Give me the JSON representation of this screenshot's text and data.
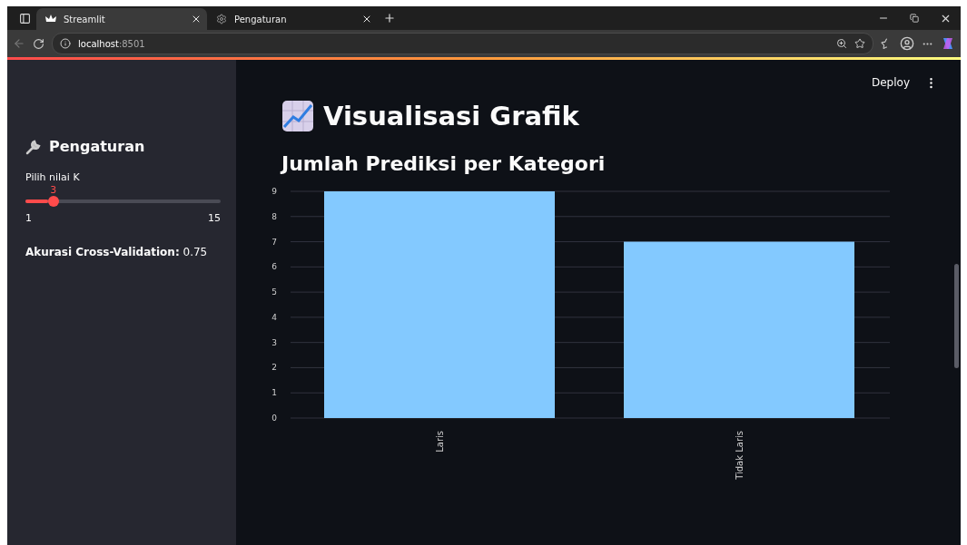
{
  "browser": {
    "tabs": [
      {
        "title": "Streamlit",
        "selected": true,
        "kind": "app"
      },
      {
        "title": "Pengaturan",
        "selected": false,
        "kind": "settings"
      }
    ],
    "address": {
      "host": "localhost",
      "port": ":8501"
    }
  },
  "header": {
    "deploy": "Deploy"
  },
  "sidebar": {
    "title": "Pengaturan",
    "slider": {
      "label": "Pilih nilai K",
      "value": "3",
      "min": "1",
      "max": "15",
      "level": 0.143
    },
    "accuracy": "**Akurasi Cross-Validation:** 0.75"
  },
  "main": {
    "title": "Visualisasi Grafik",
    "subtitle": "Jumlah Prediksi per Kategori",
    "chart_data": {
      "type": "bar",
      "grid": true,
      "categories": [
        "Laris",
        "Tidak Laris"
      ],
      "values": [
        9,
        7
      ],
      "ylim": [
        0,
        9
      ],
      "yticks": [
        0,
        1,
        2,
        3,
        4,
        5,
        6,
        7,
        8,
        9
      ]
    }
  }
}
